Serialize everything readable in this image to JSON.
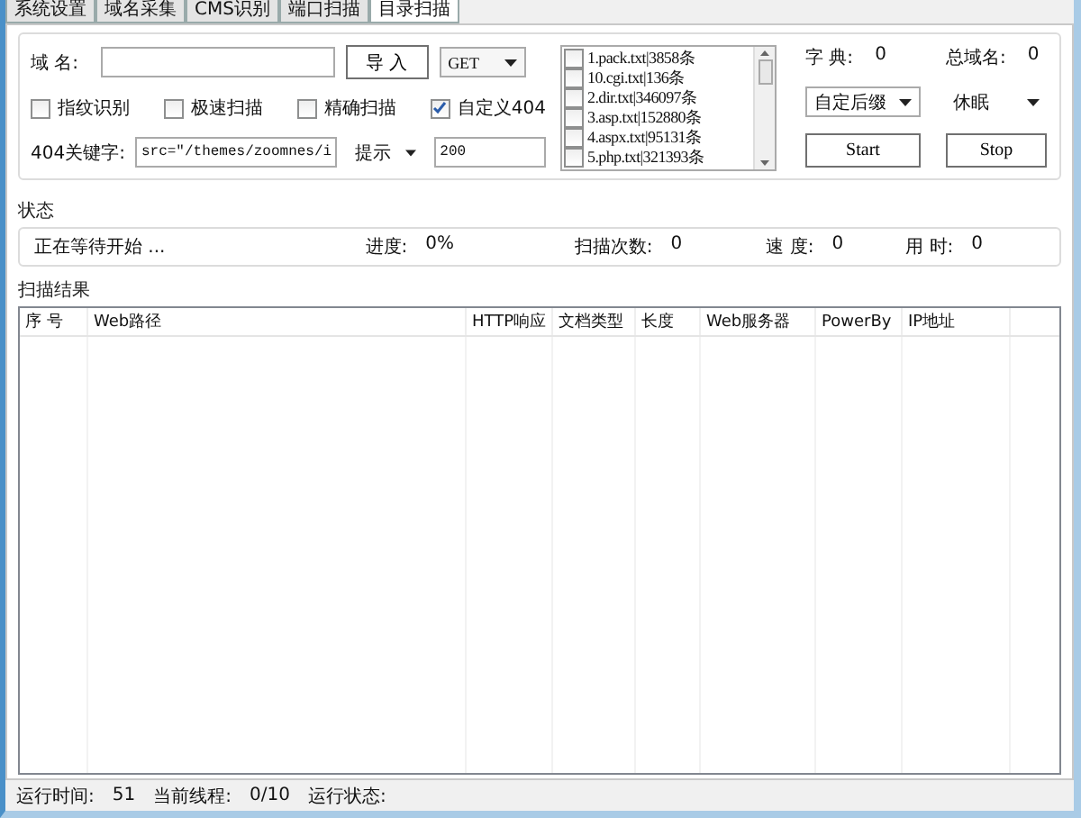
{
  "tabs": [
    {
      "label": "系统设置",
      "selected": false
    },
    {
      "label": "域名采集",
      "selected": false
    },
    {
      "label": "CMS识别",
      "selected": false
    },
    {
      "label": "端口扫描",
      "selected": false
    },
    {
      "label": "目录扫描",
      "selected": true
    }
  ],
  "domain": {
    "label": "域 名:",
    "import_button": "导 入",
    "method": "GET"
  },
  "options": [
    {
      "label": "指纹识别",
      "checked": false
    },
    {
      "label": "极速扫描",
      "checked": false
    },
    {
      "label": "精确扫描",
      "checked": false
    },
    {
      "label": "自定义404",
      "checked": true
    }
  ],
  "keyword": {
    "label": "404关键字:",
    "value": "src=\"/themes/zoomnes/i",
    "hint_select": "提示"
  },
  "code_field": {
    "value": "200"
  },
  "dictionaries": [
    {
      "label": "1.pack.txt|3858条",
      "checked": false
    },
    {
      "label": "10.cgi.txt|136条",
      "checked": false
    },
    {
      "label": "2.dir.txt|346097条",
      "checked": false
    },
    {
      "label": "3.asp.txt|152880条",
      "checked": false
    },
    {
      "label": "4.aspx.txt|95131条",
      "checked": false
    },
    {
      "label": "5.php.txt|321393条",
      "checked": false
    }
  ],
  "counters": [
    {
      "label": "字 典:",
      "value": "0"
    },
    {
      "label": "总域名:",
      "value": "0"
    }
  ],
  "suffix_select": "自定后缀",
  "sleep_select": "休眠",
  "start_button": "Start",
  "stop_button": "Stop",
  "status": {
    "title": "状态",
    "message": "正在等待开始 ...",
    "fields": [
      {
        "label": "进度:",
        "value": "0%"
      },
      {
        "label": "扫描次数:",
        "value": "0"
      },
      {
        "label": "速 度:",
        "value": "0"
      },
      {
        "label": "用 时:",
        "value": "0"
      }
    ]
  },
  "results": {
    "title": "扫描结果",
    "columns": [
      "序 号",
      "Web路径",
      "HTTP响应",
      "文档类型",
      "长度",
      "Web服务器",
      "PowerBy",
      "IP地址"
    ]
  },
  "status_bar": [
    {
      "label": "运行时间:",
      "value": "51"
    },
    {
      "label": "当前线程:",
      "value": "0/10"
    },
    {
      "label": "运行状态:"
    }
  ]
}
